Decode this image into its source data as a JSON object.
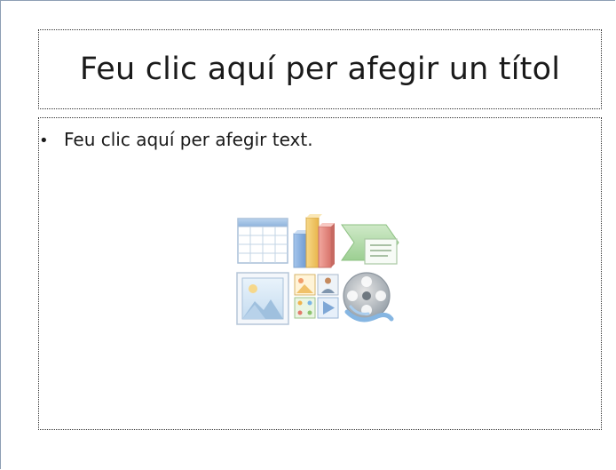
{
  "slide": {
    "title_placeholder": "Feu clic aquí per afegir un títol",
    "body_placeholder": {
      "bullet": "•",
      "text": "Feu clic aquí per afegir text."
    },
    "content_icons": [
      "insert-table-icon",
      "insert-chart-icon",
      "insert-smartart-icon",
      "insert-picture-icon",
      "insert-clipart-icon",
      "insert-media-icon"
    ]
  }
}
